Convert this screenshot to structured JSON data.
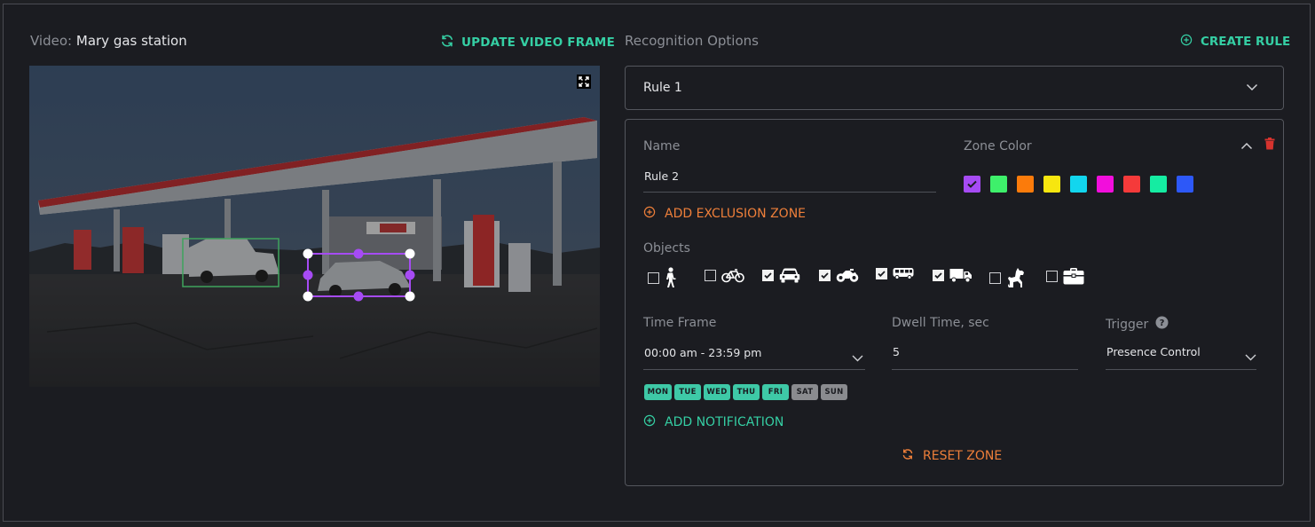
{
  "video": {
    "label": "Video:",
    "name": "Mary gas station",
    "update_label": "UPDATE VIDEO FRAME"
  },
  "recognition": {
    "title": "Recognition Options",
    "create_label": "CREATE RULE",
    "selected_rule": "Rule 1"
  },
  "rule": {
    "name_label": "Name",
    "name_value": "Rule 2",
    "zone_color_label": "Zone Color",
    "zone_colors": [
      "#a64bf4",
      "#3ef06b",
      "#fb7b0b",
      "#f7e60f",
      "#12d6ee",
      "#f20edc",
      "#f53a3a",
      "#15eca2",
      "#2d58f8"
    ],
    "selected_color": "#a64bf4",
    "add_exclusion_label": "ADD EXCLUSION ZONE",
    "objects_label": "Objects",
    "objects": [
      {
        "icon": "person-icon",
        "checked": false
      },
      {
        "icon": "bicycle-icon",
        "checked": false
      },
      {
        "icon": "car-icon",
        "checked": true
      },
      {
        "icon": "motorcycle-icon",
        "checked": true
      },
      {
        "icon": "bus-icon",
        "checked": true
      },
      {
        "icon": "truck-icon",
        "checked": true
      },
      {
        "icon": "dog-icon",
        "checked": false
      },
      {
        "icon": "suitcase-icon",
        "checked": false
      }
    ],
    "time_frame_label": "Time Frame",
    "time_frame_value": "00:00 am - 23:59 pm",
    "dwell_label": "Dwell Time, sec",
    "dwell_value": "5",
    "trigger_label": "Trigger",
    "trigger_value": "Presence Control",
    "days": [
      {
        "label": "MON",
        "active": true
      },
      {
        "label": "TUE",
        "active": true
      },
      {
        "label": "WED",
        "active": true
      },
      {
        "label": "THU",
        "active": true
      },
      {
        "label": "FRI",
        "active": true
      },
      {
        "label": "SAT",
        "active": false
      },
      {
        "label": "SUN",
        "active": false
      }
    ],
    "add_notification_label": "ADD NOTIFICATION",
    "reset_label": "RESET ZONE"
  },
  "colors": {
    "accent_green": "#35cfa4",
    "accent_orange": "#ee7f3a",
    "delete_red": "#d6332e",
    "day_active": "#3ec9a7",
    "day_inactive": "#8a8b8f"
  }
}
